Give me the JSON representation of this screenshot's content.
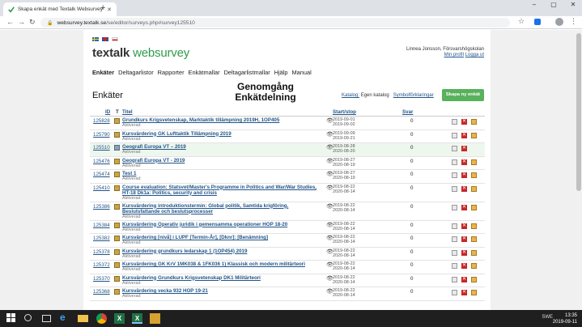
{
  "browser": {
    "tab_title": "Skapa enkät med Textalk Websurvey",
    "url_host": "websurvey.textalk.se",
    "url_path": "/se/editor/surveys.php#survey125510",
    "win_min": "–",
    "win_max": "▢",
    "win_close": "✕"
  },
  "site": {
    "logo_a": "textalk",
    "logo_b": " websurvey",
    "user_name": "Linnea Jonsson, Försvarshögskolan",
    "link_profile": "Min profil",
    "link_logout": "Logga ut",
    "nav": [
      "Enkäter",
      "Deltagarlistor",
      "Rapporter",
      "Enkätmallar",
      "Deltagarlistmallar",
      "Hjälp",
      "Manual"
    ],
    "page_title": "Enkäter",
    "center_heading": "Genomgång Enkätdelning",
    "catalog_label": "Katalog:",
    "catalog_value": " Egen katalog",
    "symbol_link": "Symbolförklaringar",
    "new_survey_button": "Skapa ny enkät"
  },
  "table": {
    "headers": {
      "id": "ID",
      "t": "T",
      "title": "Titel",
      "startstop": "Start/stop",
      "svar": "Svar"
    },
    "rows": [
      {
        "id": "125828",
        "title": "Grundkurs Krigsvetenskap, Marktaktik tillämpning 2019H, 1OP405",
        "status": "Aktiverad",
        "start": "2019-09-01",
        "stop": "2019-09-02",
        "svar": "0"
      },
      {
        "id": "125790",
        "title": "Kursvärdering GK Lufttaktik Tillämpning 2019",
        "status": "Aktiverad",
        "start": "2019-09-09",
        "stop": "2019-09-21",
        "svar": "0"
      },
      {
        "id": "125510",
        "title": "Geografi Europa VT – 2019",
        "status": "Aktiverad",
        "start": "2019-08-28",
        "stop": "2020-08-20",
        "svar": "0"
      },
      {
        "id": "125476",
        "title": "Geografi Europa VT - 2019",
        "status": "Aktiverad",
        "start": "2019-08-27",
        "stop": "2020-08-19",
        "svar": "0"
      },
      {
        "id": "125474",
        "title": "Test 1",
        "status": "Aktiverad",
        "start": "2019-08-27",
        "stop": "2020-08-19",
        "svar": "0"
      },
      {
        "id": "125410",
        "title": "Course evaluation: Statsvet/Master's Programme in Politics and War/War Studies, HT-18 Dk1a: Politics, security and crisis",
        "status": "Aktiverad",
        "start": "2019-08-22",
        "stop": "2020-08-14",
        "svar": "0"
      },
      {
        "id": "125386",
        "title": "Kursvärdering introduktionstermin: Global politik, Samtida krigföring, Beslutsfattande och beslutsprocesser",
        "status": "Aktiverad",
        "start": "2019-08-22",
        "stop": "2020-08-14",
        "svar": "0"
      },
      {
        "id": "125384",
        "title": "Kursvärdering Operativ juridik i gemensamma operationer HOP 18-20",
        "status": "Aktiverad",
        "start": "2019-08-22",
        "stop": "2020-08-14",
        "svar": "0"
      },
      {
        "id": "125382",
        "title": "Kursvärdering [nivå] i LUPF [Termin-År], [Dknr]: [Benämning]",
        "status": "Aktiverad",
        "start": "2019-08-22",
        "stop": "2020-08-14",
        "svar": "0"
      },
      {
        "id": "125378",
        "title": "Kursvärdering grundkurs ledarskap 1 (1OP454) 2019",
        "status": "Aktiverad",
        "start": "2019-08-22",
        "stop": "2020-08-14",
        "svar": "0"
      },
      {
        "id": "125372",
        "title": "Kursvärdering GK KrV 1MK038 & 1FK036 1) Klassisk och modern militärteori",
        "status": "Aktiverad",
        "start": "2019-08-22",
        "stop": "2020-08-14",
        "svar": "0"
      },
      {
        "id": "125370",
        "title": "Kursvärdering Grundkurs Krigsvetenskap DK1 Militärteori",
        "status": "Aktiverad",
        "start": "2019-08-22",
        "stop": "2020-08-14",
        "svar": "0"
      },
      {
        "id": "125368",
        "title": "Kursvärdering vecka 932 HOP 19-21",
        "status": "Aktiverad",
        "start": "2019-08-22",
        "stop": "2020-08-14",
        "svar": "0"
      }
    ]
  },
  "taskbar": {
    "lang": "SWE",
    "time": "13:35",
    "date": "2019-09-11",
    "excel_label": "X"
  }
}
